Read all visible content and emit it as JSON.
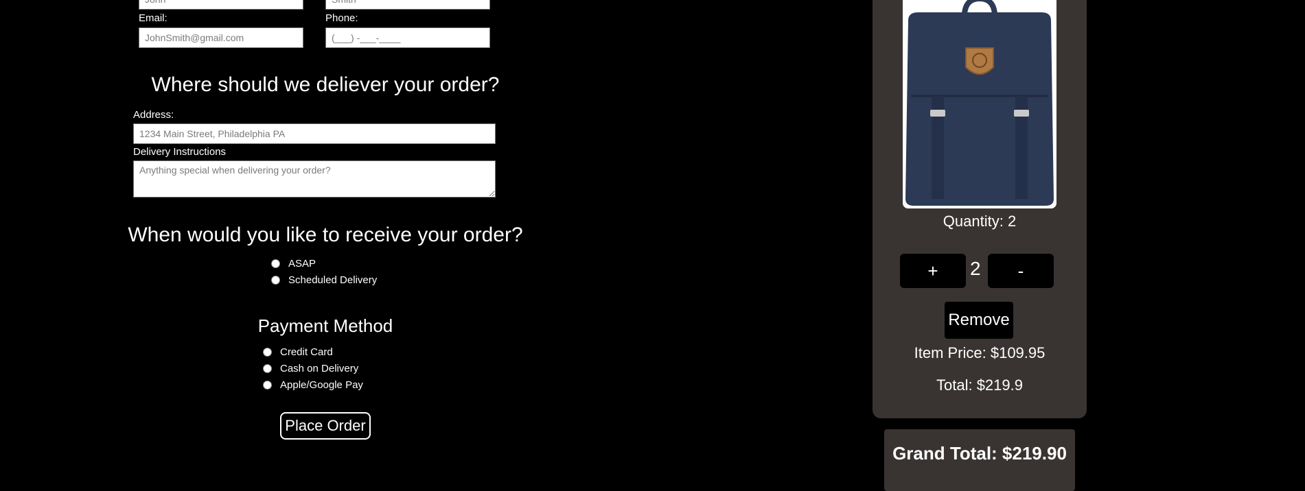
{
  "contact": {
    "first_placeholder": "John",
    "last_placeholder": "Smith",
    "email_label": "Email:",
    "email_placeholder": "JohnSmith@gmail.com",
    "phone_label": "Phone:",
    "phone_placeholder": "(___) -___-____"
  },
  "delivery": {
    "title": "Where should we deliever your order?",
    "address_label": "Address:",
    "address_placeholder": "1234 Main Street, Philadelphia PA",
    "instructions_label": "Delivery Instructions",
    "instructions_placeholder": "Anything special when delivering your order?"
  },
  "timing": {
    "title": "When would you like to receive your order?",
    "options": [
      "ASAP",
      "Scheduled Delivery"
    ]
  },
  "payment": {
    "title": "Payment Method",
    "options": [
      "Credit Card",
      "Cash on Delivery",
      "Apple/Google Pay"
    ],
    "place_order": "Place Order"
  },
  "cart": {
    "quantity_label": "Quantity: 2",
    "plus": "+",
    "count": "2",
    "minus": "-",
    "remove": "Remove",
    "item_price": "Item Price: $109.95",
    "total": "Total: $219.9",
    "grand_total": "Grand Total: $219.90",
    "product_image": "navy-backpack-image"
  },
  "colors": {
    "background": "#000000",
    "card": "#393432",
    "backpack": "#2c3a55",
    "logo_patch": "#b07a44"
  }
}
